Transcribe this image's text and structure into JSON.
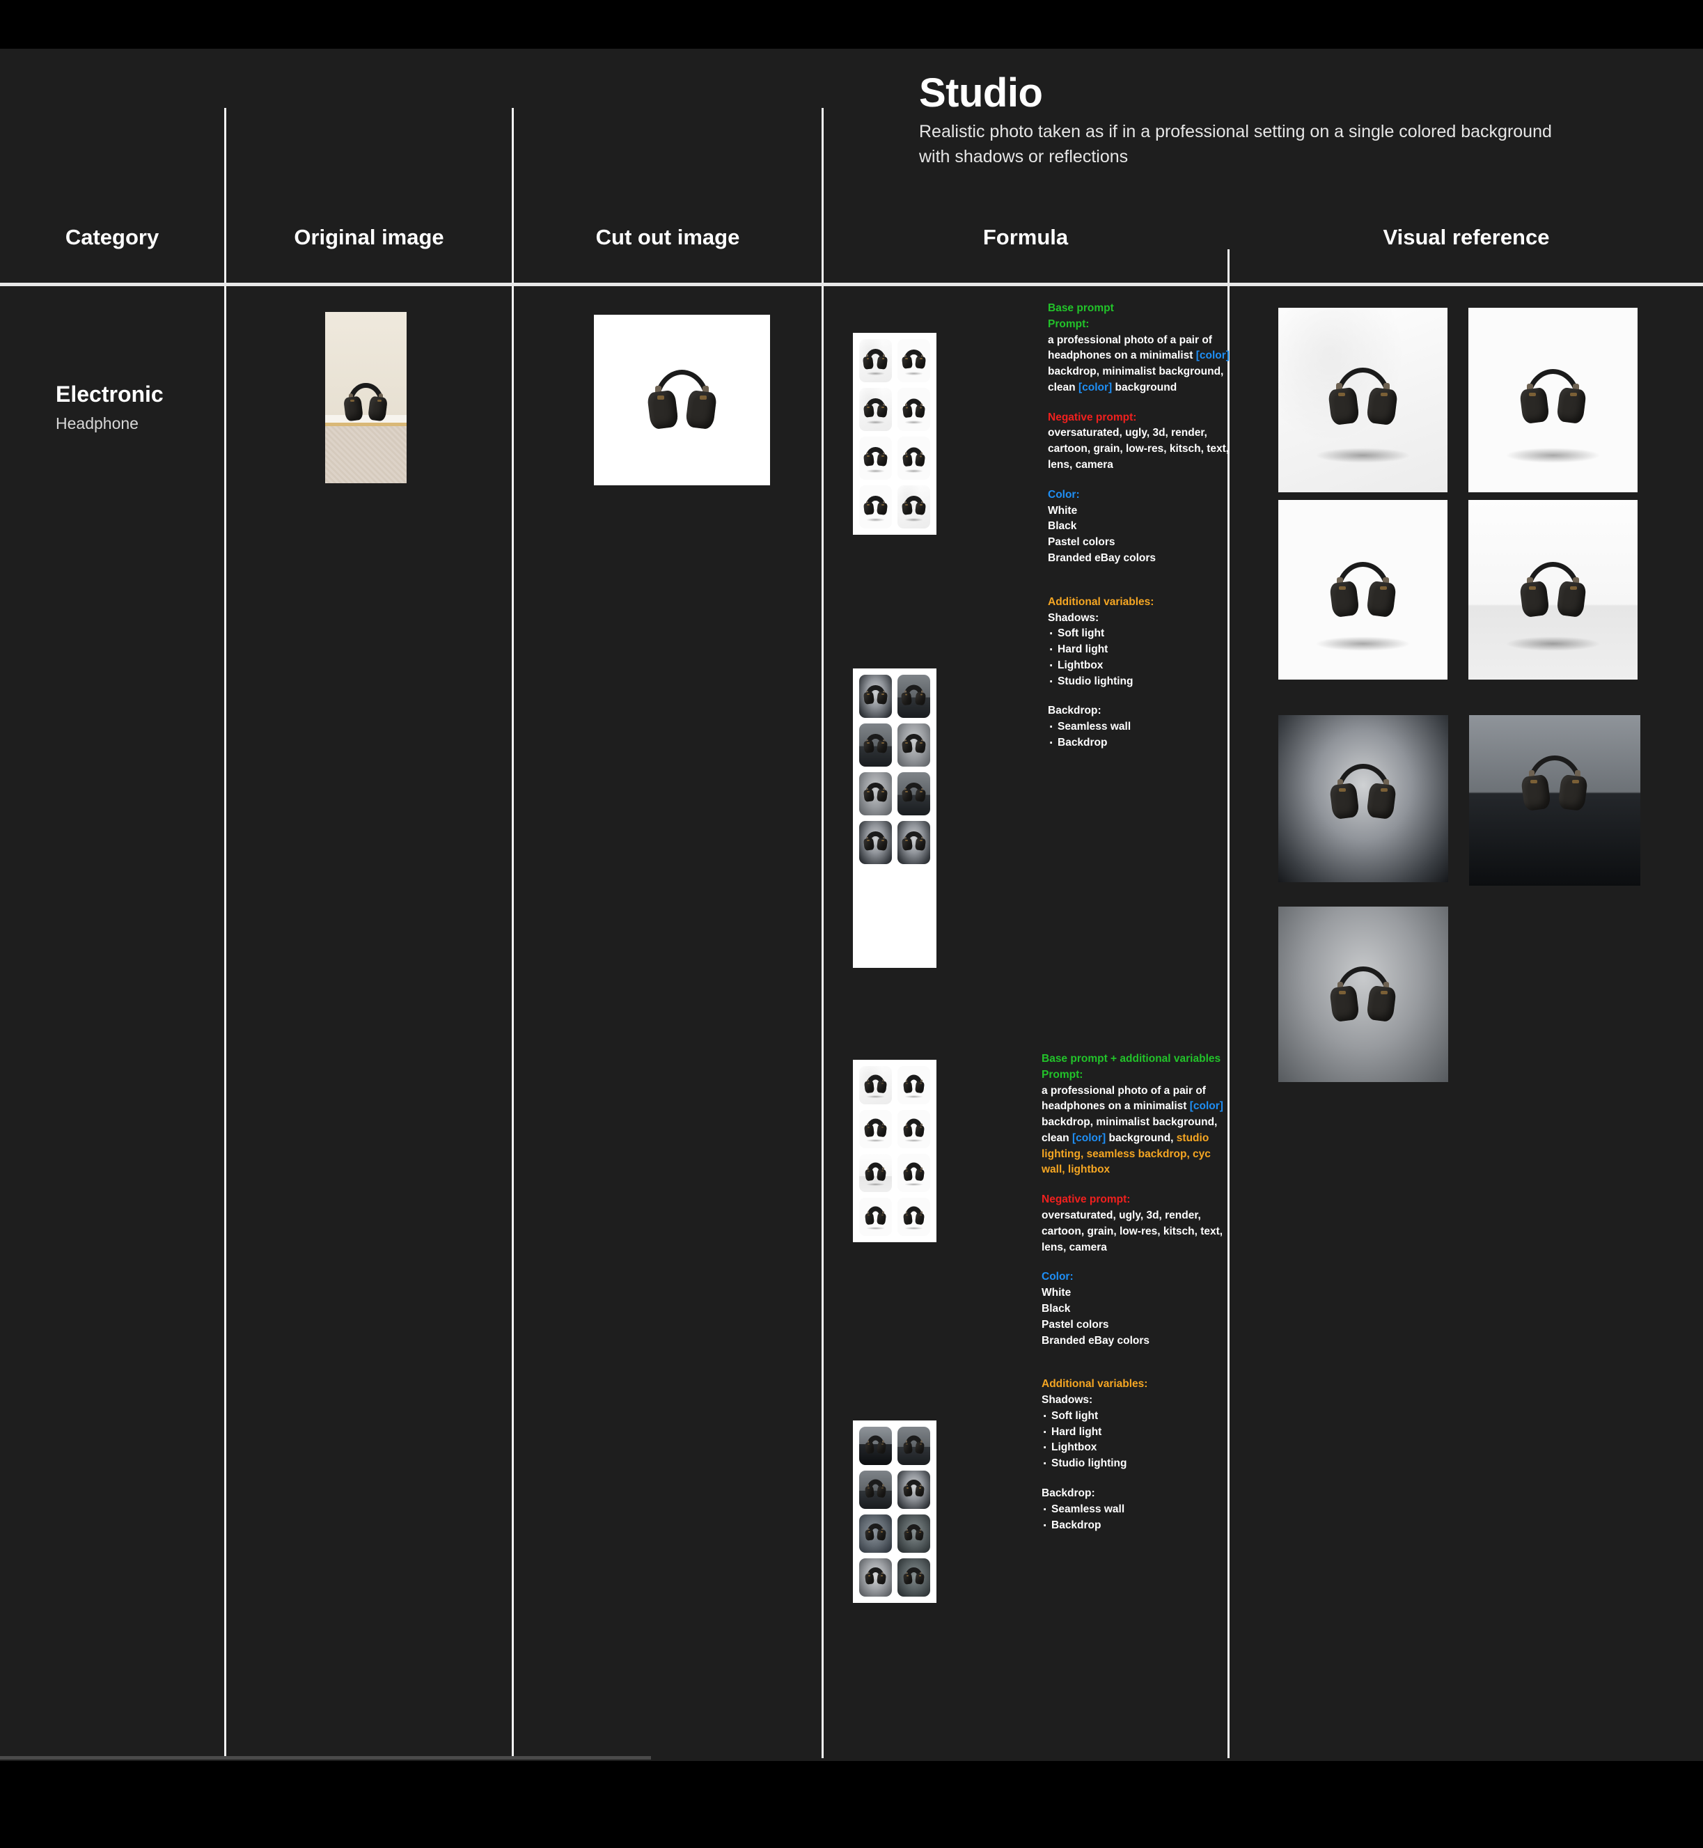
{
  "header": {
    "title": "Studio",
    "subtitle": "Realistic photo taken as if in a professional setting on a single colored background with shadows or reflections"
  },
  "columns": {
    "category": "Category",
    "original_image": "Original image",
    "cut_out_image": "Cut out image",
    "formula": "Formula",
    "visual_reference": "Visual reference"
  },
  "row": {
    "category_title": "Electronic",
    "category_subtitle": "Headphone"
  },
  "colors": {
    "page_background": "#1e1e1e",
    "bar_background": "#000000",
    "divider": "#f2f2f2",
    "heading_green": "#22c32a",
    "heading_red": "#f0201e",
    "heading_blue": "#1f8ff5",
    "heading_orange": "#f5a623",
    "text_white": "#ffffff"
  },
  "formula_blocks": [
    {
      "section_label": "Base prompt",
      "prompt_label": "Prompt:",
      "prompt_parts": [
        {
          "text": "a professional photo of a pair of headphones on a minimalist ",
          "style": "normal"
        },
        {
          "text": "[color]",
          "style": "blue"
        },
        {
          "text": " backdrop, minimalist background, clean ",
          "style": "normal"
        },
        {
          "text": "[color]",
          "style": "blue"
        },
        {
          "text": " background",
          "style": "normal"
        }
      ],
      "negative_label": "Negative prompt:",
      "negative_text": "oversaturated, ugly, 3d, render, cartoon, grain, low-res, kitsch, text, lens, camera",
      "color_label": "Color:",
      "color_options": [
        "White",
        "Black",
        "Pastel colors",
        "Branded eBay colors"
      ],
      "additional_label": "Additional variables:",
      "shadows_label": "Shadows:",
      "shadows": [
        "Soft light",
        "Hard light",
        "Lightbox",
        "Studio lighting"
      ],
      "backdrop_label": "Backdrop:",
      "backdrop": [
        "Seamless wall",
        "Backdrop"
      ]
    },
    {
      "section_label": "Base prompt + additional variables",
      "prompt_label": "Prompt:",
      "prompt_parts": [
        {
          "text": "a professional photo of a pair of headphones on a minimalist ",
          "style": "normal"
        },
        {
          "text": "[color]",
          "style": "blue"
        },
        {
          "text": " backdrop, minimalist background, clean ",
          "style": "normal"
        },
        {
          "text": "[color]",
          "style": "blue"
        },
        {
          "text": " background, ",
          "style": "normal"
        },
        {
          "text": "studio lighting, seamless backdrop, cyc wall, lightbox",
          "style": "orange"
        }
      ],
      "negative_label": "Negative prompt:",
      "negative_text": "oversaturated, ugly, 3d, render, cartoon, grain, low-res, kitsch, text, lens, camera",
      "color_label": "Color:",
      "color_options": [
        "White",
        "Black",
        "Pastel colors",
        "Branded eBay colors"
      ],
      "additional_label": "Additional variables:",
      "shadows_label": "Shadows:",
      "shadows": [
        "Soft light",
        "Hard light",
        "Lightbox",
        "Studio lighting"
      ],
      "backdrop_label": "Backdrop:",
      "backdrop": [
        "Seamless wall",
        "Backdrop"
      ]
    }
  ],
  "image_grids": [
    {
      "id": "grid-light-1",
      "surfaces": [
        "s-whitecloth",
        "s-white",
        "s-whitecloth",
        "s-white",
        "s-white",
        "s-white",
        "s-white",
        "s-whitecloth"
      ]
    },
    {
      "id": "grid-dark-1",
      "surfaces": [
        "s-vignette",
        "s-darkdesk",
        "s-darkdesk",
        "s-graysoft",
        "s-graysoft",
        "s-darkdesk",
        "s-vignette",
        "s-vignette"
      ]
    },
    {
      "id": "grid-light-2",
      "surfaces": [
        "s-whitecloth",
        "s-white",
        "s-white",
        "s-white",
        "s-whitestep",
        "s-white",
        "s-white",
        "s-white"
      ]
    },
    {
      "id": "grid-dark-2",
      "surfaces": [
        "s-darkrefl",
        "s-darkdesk",
        "s-darkdesk",
        "s-vignette",
        "s-dimblue",
        "s-dimteal",
        "s-graylight",
        "s-dimteal"
      ]
    }
  ],
  "visual_reference_images": [
    {
      "id": "ref-1",
      "surface": "s-whitecloth"
    },
    {
      "id": "ref-2",
      "surface": "s-white"
    },
    {
      "id": "ref-3",
      "surface": "s-white"
    },
    {
      "id": "ref-4",
      "surface": "s-whitestep"
    },
    {
      "id": "ref-5",
      "surface": "s-vignette"
    },
    {
      "id": "ref-6",
      "surface": "s-darkrefl"
    },
    {
      "id": "ref-7",
      "surface": "s-graysoft"
    }
  ]
}
